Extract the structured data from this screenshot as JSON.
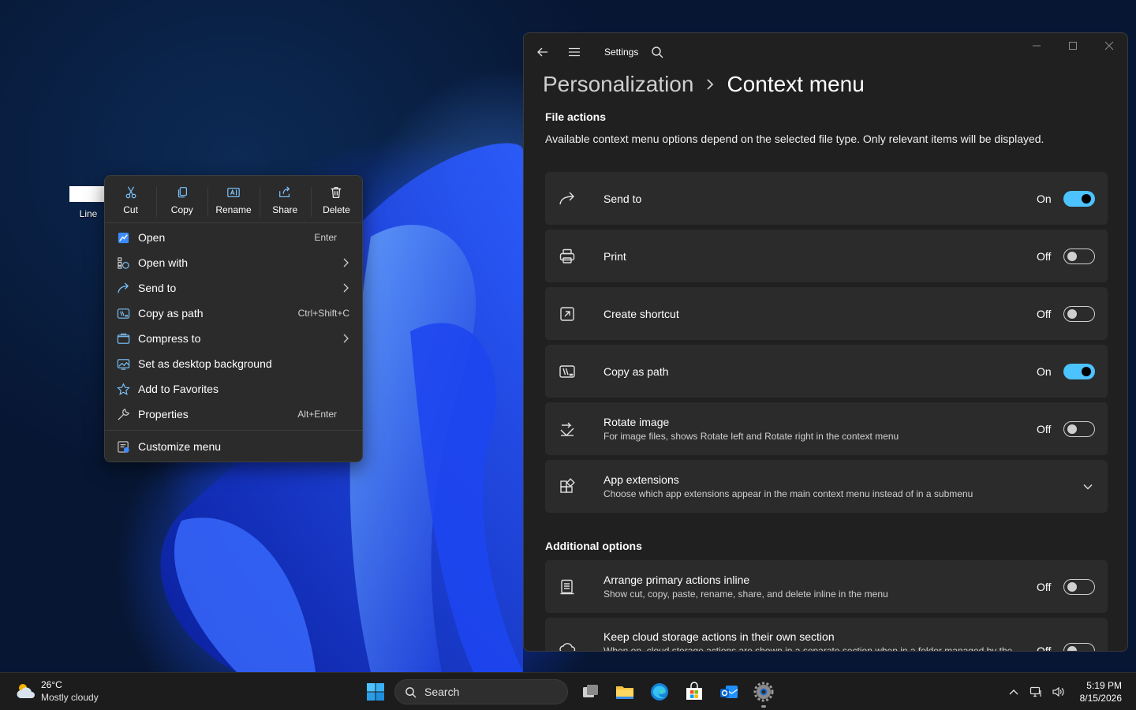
{
  "desktop": {
    "file_label": "Line"
  },
  "context_menu": {
    "actions": [
      {
        "label": "Cut",
        "icon": "scissors-icon"
      },
      {
        "label": "Copy",
        "icon": "copy-icon"
      },
      {
        "label": "Rename",
        "icon": "rename-icon"
      },
      {
        "label": "Share",
        "icon": "share-icon"
      },
      {
        "label": "Delete",
        "icon": "trash-icon"
      }
    ],
    "items": [
      {
        "label": "Open",
        "shortcut": "Enter",
        "icon": "open-icon"
      },
      {
        "label": "Open with",
        "shortcut": "",
        "icon": "open-with-icon",
        "submenu": true
      },
      {
        "label": "Send to",
        "shortcut": "",
        "icon": "send-to-icon",
        "submenu": true
      },
      {
        "label": "Copy as path",
        "shortcut": "Ctrl+Shift+C",
        "icon": "copy-path-icon"
      },
      {
        "label": "Compress to",
        "shortcut": "",
        "icon": "compress-icon",
        "submenu": true
      },
      {
        "label": "Set as desktop background",
        "shortcut": "",
        "icon": "desktop-background-icon"
      },
      {
        "label": "Add to Favorites",
        "shortcut": "",
        "icon": "star-icon"
      },
      {
        "label": "Properties",
        "shortcut": "Alt+Enter",
        "icon": "wrench-icon"
      }
    ],
    "footer_item": {
      "label": "Customize menu",
      "icon": "customize-icon"
    }
  },
  "settings": {
    "app_title": "Settings",
    "breadcrumb_parent": "Personalization",
    "breadcrumb_current": "Context menu",
    "section1_title": "File actions",
    "section1_desc": "Available context menu options depend on the selected file type. Only relevant items will be displayed.",
    "cards": [
      {
        "title": "Send to",
        "subtitle": "",
        "state": "On",
        "on": true,
        "icon": "send-to-icon"
      },
      {
        "title": "Print",
        "subtitle": "",
        "state": "Off",
        "on": false,
        "icon": "printer-icon"
      },
      {
        "title": "Create shortcut",
        "subtitle": "",
        "state": "Off",
        "on": false,
        "icon": "shortcut-icon"
      },
      {
        "title": "Copy as path",
        "subtitle": "",
        "state": "On",
        "on": true,
        "icon": "copy-path-icon"
      },
      {
        "title": "Rotate image",
        "subtitle": "For image files, shows Rotate left and Rotate right in the context menu",
        "state": "Off",
        "on": false,
        "icon": "rotate-icon"
      },
      {
        "title": "App extensions",
        "subtitle": "Choose which app extensions appear in the main context menu instead of in a submenu",
        "state": "",
        "expandable": true,
        "icon": "extensions-icon"
      }
    ],
    "section2_title": "Additional options",
    "cards2": [
      {
        "title": "Arrange primary actions inline",
        "subtitle": "Show cut, copy, paste, rename, share, and delete inline in the menu",
        "state": "Off",
        "on": false,
        "icon": "list-icon"
      },
      {
        "title": "Keep cloud storage actions in their own section",
        "subtitle": "When on, cloud storage actions are shown in a separate section when in a folder managed by the",
        "state": "Off",
        "on": false,
        "icon": "cloud-icon"
      }
    ]
  },
  "taskbar": {
    "weather_temp": "26°C",
    "weather_desc": "Mostly cloudy",
    "search_label": "Search",
    "time": "5:19 PM",
    "date": "8/15/2026"
  },
  "colors": {
    "accent": "#4cc2ff",
    "window_bg": "#202020",
    "card_bg": "#2b2b2b"
  }
}
